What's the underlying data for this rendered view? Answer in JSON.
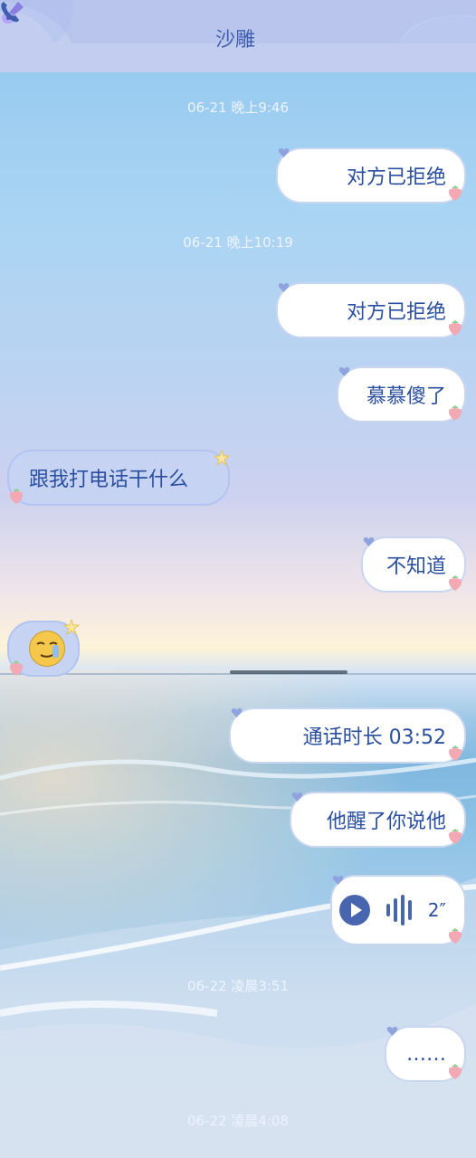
{
  "header": {
    "title": "沙雕",
    "left_icon": "guitar-icon",
    "right_icon": "phone-icon"
  },
  "colors": {
    "header_bg": "#c2cdf0",
    "accent": "#3f5fae",
    "bubble_out": "#ffffff",
    "bubble_in": "#c7d3f3"
  },
  "messages": [
    {
      "type": "timestamp",
      "text": "06-21 晚上9:46"
    },
    {
      "type": "outgoing",
      "text": "对方已拒绝"
    },
    {
      "type": "timestamp",
      "text": "06-21 晚上10:19"
    },
    {
      "type": "outgoing",
      "text": "对方已拒绝"
    },
    {
      "type": "outgoing",
      "text": "慕慕傻了"
    },
    {
      "type": "incoming",
      "text": "跟我打电话干什么"
    },
    {
      "type": "outgoing",
      "text": "不知道"
    },
    {
      "type": "incoming-sticker",
      "icon": "smirk-emoji-icon"
    },
    {
      "type": "outgoing",
      "text": "通话时长 03:52"
    },
    {
      "type": "outgoing",
      "text": "他醒了你说他"
    },
    {
      "type": "outgoing-voice",
      "duration": "2″"
    },
    {
      "type": "timestamp",
      "text": "06-22 凌晨3:51"
    },
    {
      "type": "outgoing",
      "text": "……"
    },
    {
      "type": "timestamp",
      "text": "06-22 凌晨4:08"
    }
  ]
}
